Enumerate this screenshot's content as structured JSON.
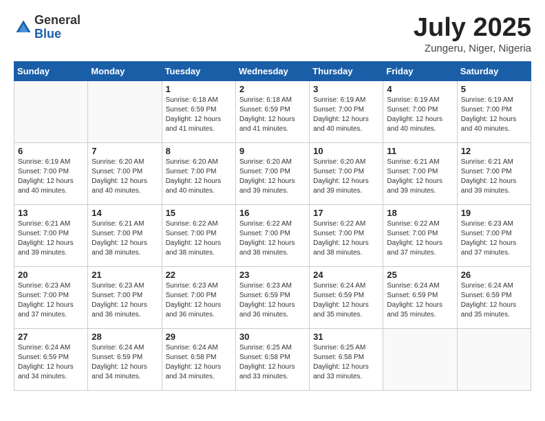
{
  "logo": {
    "general": "General",
    "blue": "Blue"
  },
  "title": "July 2025",
  "location": "Zungeru, Niger, Nigeria",
  "days_of_week": [
    "Sunday",
    "Monday",
    "Tuesday",
    "Wednesday",
    "Thursday",
    "Friday",
    "Saturday"
  ],
  "weeks": [
    [
      {
        "day": "",
        "info": ""
      },
      {
        "day": "",
        "info": ""
      },
      {
        "day": "1",
        "info": "Sunrise: 6:18 AM\nSunset: 6:59 PM\nDaylight: 12 hours and 41 minutes."
      },
      {
        "day": "2",
        "info": "Sunrise: 6:18 AM\nSunset: 6:59 PM\nDaylight: 12 hours and 41 minutes."
      },
      {
        "day": "3",
        "info": "Sunrise: 6:19 AM\nSunset: 7:00 PM\nDaylight: 12 hours and 40 minutes."
      },
      {
        "day": "4",
        "info": "Sunrise: 6:19 AM\nSunset: 7:00 PM\nDaylight: 12 hours and 40 minutes."
      },
      {
        "day": "5",
        "info": "Sunrise: 6:19 AM\nSunset: 7:00 PM\nDaylight: 12 hours and 40 minutes."
      }
    ],
    [
      {
        "day": "6",
        "info": "Sunrise: 6:19 AM\nSunset: 7:00 PM\nDaylight: 12 hours and 40 minutes."
      },
      {
        "day": "7",
        "info": "Sunrise: 6:20 AM\nSunset: 7:00 PM\nDaylight: 12 hours and 40 minutes."
      },
      {
        "day": "8",
        "info": "Sunrise: 6:20 AM\nSunset: 7:00 PM\nDaylight: 12 hours and 40 minutes."
      },
      {
        "day": "9",
        "info": "Sunrise: 6:20 AM\nSunset: 7:00 PM\nDaylight: 12 hours and 39 minutes."
      },
      {
        "day": "10",
        "info": "Sunrise: 6:20 AM\nSunset: 7:00 PM\nDaylight: 12 hours and 39 minutes."
      },
      {
        "day": "11",
        "info": "Sunrise: 6:21 AM\nSunset: 7:00 PM\nDaylight: 12 hours and 39 minutes."
      },
      {
        "day": "12",
        "info": "Sunrise: 6:21 AM\nSunset: 7:00 PM\nDaylight: 12 hours and 39 minutes."
      }
    ],
    [
      {
        "day": "13",
        "info": "Sunrise: 6:21 AM\nSunset: 7:00 PM\nDaylight: 12 hours and 39 minutes."
      },
      {
        "day": "14",
        "info": "Sunrise: 6:21 AM\nSunset: 7:00 PM\nDaylight: 12 hours and 38 minutes."
      },
      {
        "day": "15",
        "info": "Sunrise: 6:22 AM\nSunset: 7:00 PM\nDaylight: 12 hours and 38 minutes."
      },
      {
        "day": "16",
        "info": "Sunrise: 6:22 AM\nSunset: 7:00 PM\nDaylight: 12 hours and 38 minutes."
      },
      {
        "day": "17",
        "info": "Sunrise: 6:22 AM\nSunset: 7:00 PM\nDaylight: 12 hours and 38 minutes."
      },
      {
        "day": "18",
        "info": "Sunrise: 6:22 AM\nSunset: 7:00 PM\nDaylight: 12 hours and 37 minutes."
      },
      {
        "day": "19",
        "info": "Sunrise: 6:23 AM\nSunset: 7:00 PM\nDaylight: 12 hours and 37 minutes."
      }
    ],
    [
      {
        "day": "20",
        "info": "Sunrise: 6:23 AM\nSunset: 7:00 PM\nDaylight: 12 hours and 37 minutes."
      },
      {
        "day": "21",
        "info": "Sunrise: 6:23 AM\nSunset: 7:00 PM\nDaylight: 12 hours and 36 minutes."
      },
      {
        "day": "22",
        "info": "Sunrise: 6:23 AM\nSunset: 7:00 PM\nDaylight: 12 hours and 36 minutes."
      },
      {
        "day": "23",
        "info": "Sunrise: 6:23 AM\nSunset: 6:59 PM\nDaylight: 12 hours and 36 minutes."
      },
      {
        "day": "24",
        "info": "Sunrise: 6:24 AM\nSunset: 6:59 PM\nDaylight: 12 hours and 35 minutes."
      },
      {
        "day": "25",
        "info": "Sunrise: 6:24 AM\nSunset: 6:59 PM\nDaylight: 12 hours and 35 minutes."
      },
      {
        "day": "26",
        "info": "Sunrise: 6:24 AM\nSunset: 6:59 PM\nDaylight: 12 hours and 35 minutes."
      }
    ],
    [
      {
        "day": "27",
        "info": "Sunrise: 6:24 AM\nSunset: 6:59 PM\nDaylight: 12 hours and 34 minutes."
      },
      {
        "day": "28",
        "info": "Sunrise: 6:24 AM\nSunset: 6:59 PM\nDaylight: 12 hours and 34 minutes."
      },
      {
        "day": "29",
        "info": "Sunrise: 6:24 AM\nSunset: 6:58 PM\nDaylight: 12 hours and 34 minutes."
      },
      {
        "day": "30",
        "info": "Sunrise: 6:25 AM\nSunset: 6:58 PM\nDaylight: 12 hours and 33 minutes."
      },
      {
        "day": "31",
        "info": "Sunrise: 6:25 AM\nSunset: 6:58 PM\nDaylight: 12 hours and 33 minutes."
      },
      {
        "day": "",
        "info": ""
      },
      {
        "day": "",
        "info": ""
      }
    ]
  ]
}
